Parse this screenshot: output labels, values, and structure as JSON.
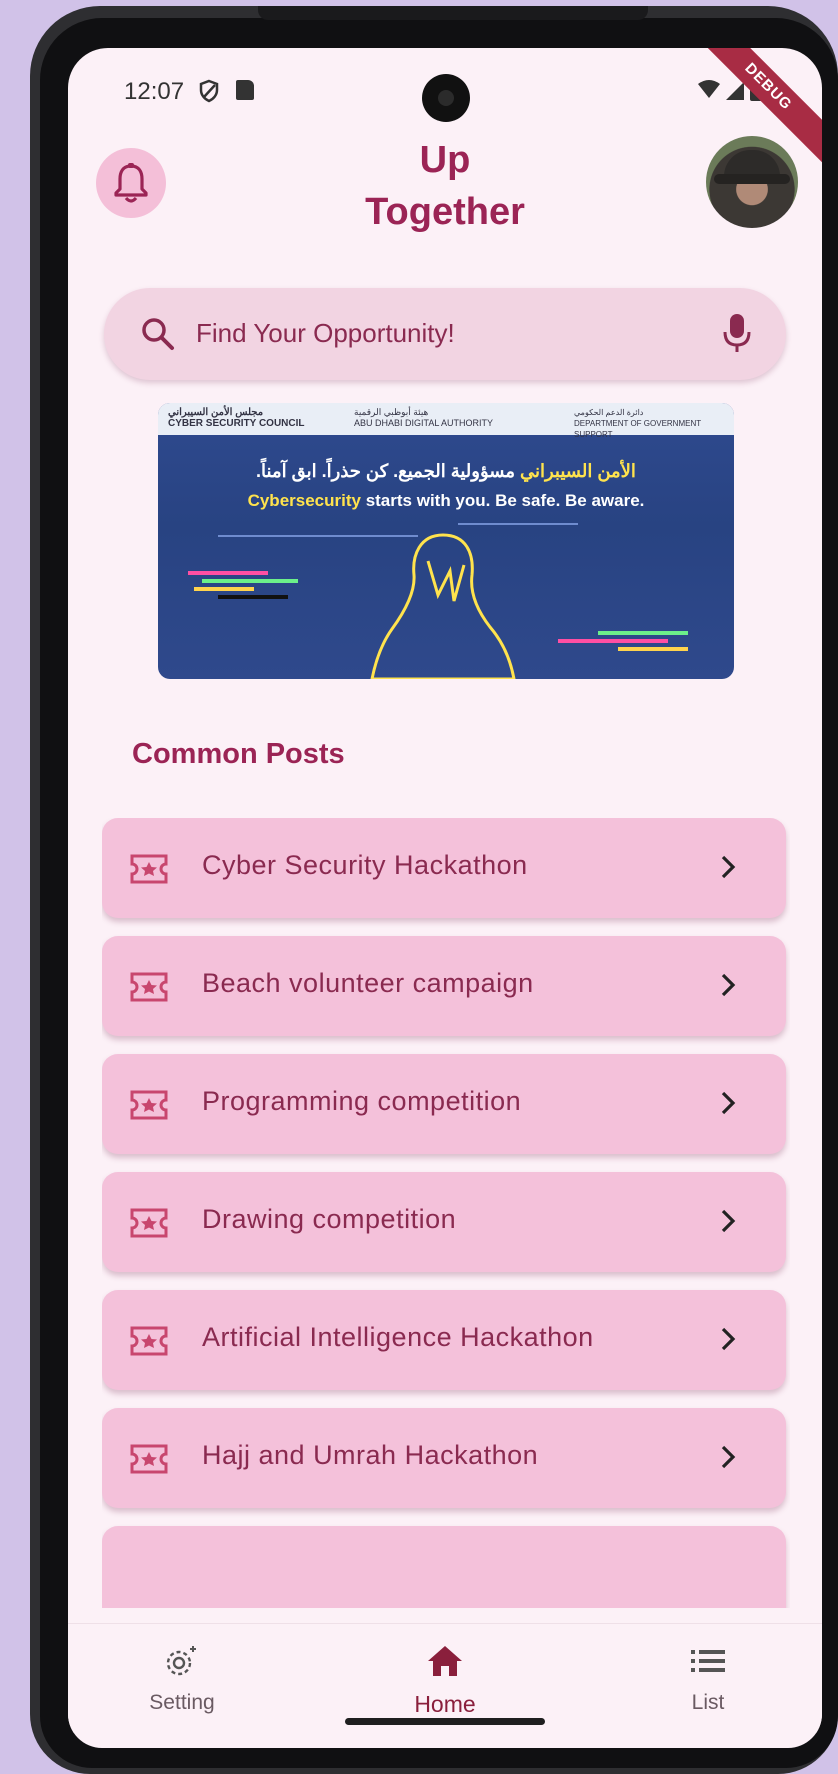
{
  "status_bar": {
    "time": "12:07",
    "debug_label": "DEBUG"
  },
  "header": {
    "title_line1": "Up",
    "title_line2": "Together"
  },
  "search": {
    "placeholder": "Find Your Opportunity!"
  },
  "banner": {
    "logo_left_ar": "مجلس الأمن السيبراني",
    "logo_left_en": "CYBER SECURITY COUNCIL",
    "logo_mid_ar": "هيئة أبوظبي الرقمية",
    "logo_mid_en": "ABU DHABI DIGITAL AUTHORITY",
    "logo_right_ar": "دائرة الدعم الحكومي",
    "logo_right_en": "DEPARTMENT OF GOVERNMENT SUPPORT",
    "arabic_highlight": "الأمن السيبراني",
    "arabic_text": " مسؤولية الجميع. كن حذراً. ابق آمناً.",
    "english_highlight": "Cybersecurity",
    "english_text": " starts with you. Be safe. Be aware."
  },
  "common_posts": {
    "title": "Common Posts",
    "items": [
      {
        "label": "Cyber Security Hackathon"
      },
      {
        "label": "Beach volunteer campaign"
      },
      {
        "label": "Programming competition"
      },
      {
        "label": "Drawing competition"
      },
      {
        "label": "Artificial Intelligence Hackathon"
      },
      {
        "label": "Hajj and Umrah Hackathon"
      },
      {
        "label": ""
      }
    ]
  },
  "bottom_nav": {
    "items": [
      {
        "label": "Setting",
        "icon": "gear-icon"
      },
      {
        "label": "Home",
        "icon": "home-icon",
        "active": true
      },
      {
        "label": "List",
        "icon": "list-icon"
      }
    ]
  },
  "colors": {
    "accent": "#9b2455",
    "card": "#f4c1da",
    "background": "#fcf1f7",
    "search_bg": "#f2d4e2"
  }
}
